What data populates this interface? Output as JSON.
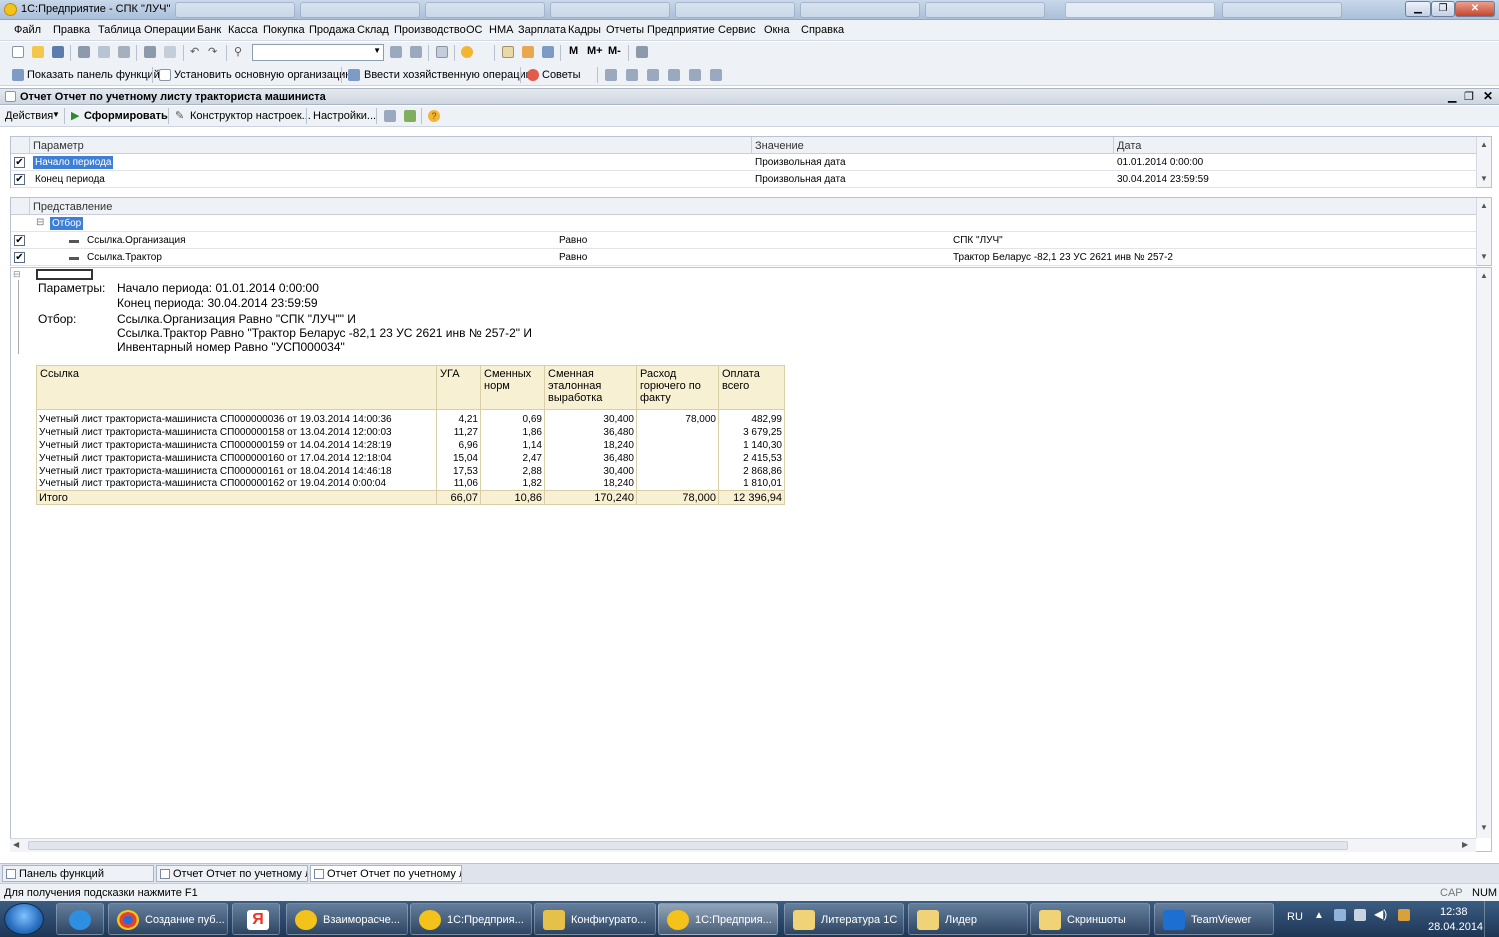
{
  "window": {
    "title": "1С:Предприятие - СПК \"ЛУЧ\""
  },
  "menu": [
    "Файл",
    "Правка",
    "Таблица",
    "Операции",
    "Банк",
    "Касса",
    "Покупка",
    "Продажа",
    "Склад",
    "Производство",
    "ОС",
    "НМА",
    "Зарплата",
    "Кадры",
    "Отчеты",
    "Предприятие",
    "Сервис",
    "Окна",
    "Справка"
  ],
  "toolbar2": {
    "show_panel": "Показать панель функций",
    "set_org": "Установить основную организацию",
    "enter_op": "Ввести хозяйственную операцию",
    "tips": "Советы"
  },
  "toolbar1": {
    "zoom_m": "M",
    "zoom_mplus": "M+",
    "zoom_mminus": "M-"
  },
  "document": {
    "title": "Отчет  Отчет по учетному листу тракториста машиниста"
  },
  "actions": {
    "actions": "Действия",
    "generate": "Сформировать",
    "constructor": "Конструктор настроек...",
    "settings": "Настройки..."
  },
  "params_grid": {
    "headers": {
      "param": "Параметр",
      "value": "Значение",
      "date": "Дата"
    },
    "rows": [
      {
        "name": "Начало периода",
        "value": "Произвольная дата",
        "date": "01.01.2014 0:00:00"
      },
      {
        "name": "Конец периода",
        "value": "Произвольная дата",
        "date": "30.04.2014 23:59:59"
      }
    ]
  },
  "filter_grid": {
    "header": "Представление",
    "group": "Отбор",
    "rows": [
      {
        "field": "Ссылка.Организация",
        "cond": "Равно",
        "value": "СПК \"ЛУЧ\""
      },
      {
        "field": "Ссылка.Трактор",
        "cond": "Равно",
        "value": "Трактор Беларус -82,1 23 УС 2621  инв № 257-2"
      }
    ]
  },
  "report": {
    "params_label": "Параметры:",
    "period_start": "Начало периода: 01.01.2014 0:00:00",
    "period_end": "Конец периода: 30.04.2014 23:59:59",
    "filter_label": "Отбор:",
    "filter1": "Ссылка.Организация Равно \"СПК \"ЛУЧ\"\" И",
    "filter2": "Ссылка.Трактор Равно \"Трактор Беларус -82,1 23 УС 2621  инв № 257-2\" И",
    "filter3": "Инвентарный номер Равно \"УСП000034\"",
    "columns": [
      "Ссылка",
      "УГА",
      "Сменных норм",
      "Сменная эталонная выработка",
      "Расход горючего по факту",
      "Оплата всего"
    ],
    "rows": [
      [
        "Учетный лист тракториста-машиниста СП000000036 от 19.03.2014 14:00:36",
        "4,21",
        "0,69",
        "30,400",
        "78,000",
        "482,99"
      ],
      [
        "Учетный лист тракториста-машиниста СП000000158 от 13.04.2014 12:00:03",
        "11,27",
        "1,86",
        "36,480",
        "",
        "3 679,25"
      ],
      [
        "Учетный лист тракториста-машиниста СП000000159 от 14.04.2014 14:28:19",
        "6,96",
        "1,14",
        "18,240",
        "",
        "1 140,30"
      ],
      [
        "Учетный лист тракториста-машиниста СП000000160 от 17.04.2014 12:18:04",
        "15,04",
        "2,47",
        "36,480",
        "",
        "2 415,53"
      ],
      [
        "Учетный лист тракториста-машиниста СП000000161 от 18.04.2014 14:46:18",
        "17,53",
        "2,88",
        "30,400",
        "",
        "2 868,86"
      ],
      [
        "Учетный лист тракториста-машиниста СП000000162 от 19.04.2014 0:00:04",
        "11,06",
        "1,82",
        "18,240",
        "",
        "1 810,01"
      ]
    ],
    "total": [
      "Итого",
      "66,07",
      "10,86",
      "170,240",
      "78,000",
      "12 396,94"
    ]
  },
  "window_tabs": [
    "Панель функций",
    "Отчет  Отчет по учетному л...",
    "Отчет  Отчет по учетному л..."
  ],
  "status": {
    "hint": "Для получения подсказки нажмите F1",
    "cap": "CAP",
    "num": "NUM"
  },
  "taskbar": {
    "items": [
      "Создание пуб...",
      "Взаиморасче...",
      "1С:Предприя...",
      "Конфигурато...",
      "1С:Предприя...",
      "Литература 1С",
      "Лидер",
      "Скриншоты",
      "TeamViewer"
    ],
    "lang": "RU",
    "time": "12:38",
    "date": "28.04.2014"
  },
  "colors": {
    "accent": "#f7f0d3",
    "selection": "#3d7fd6"
  }
}
